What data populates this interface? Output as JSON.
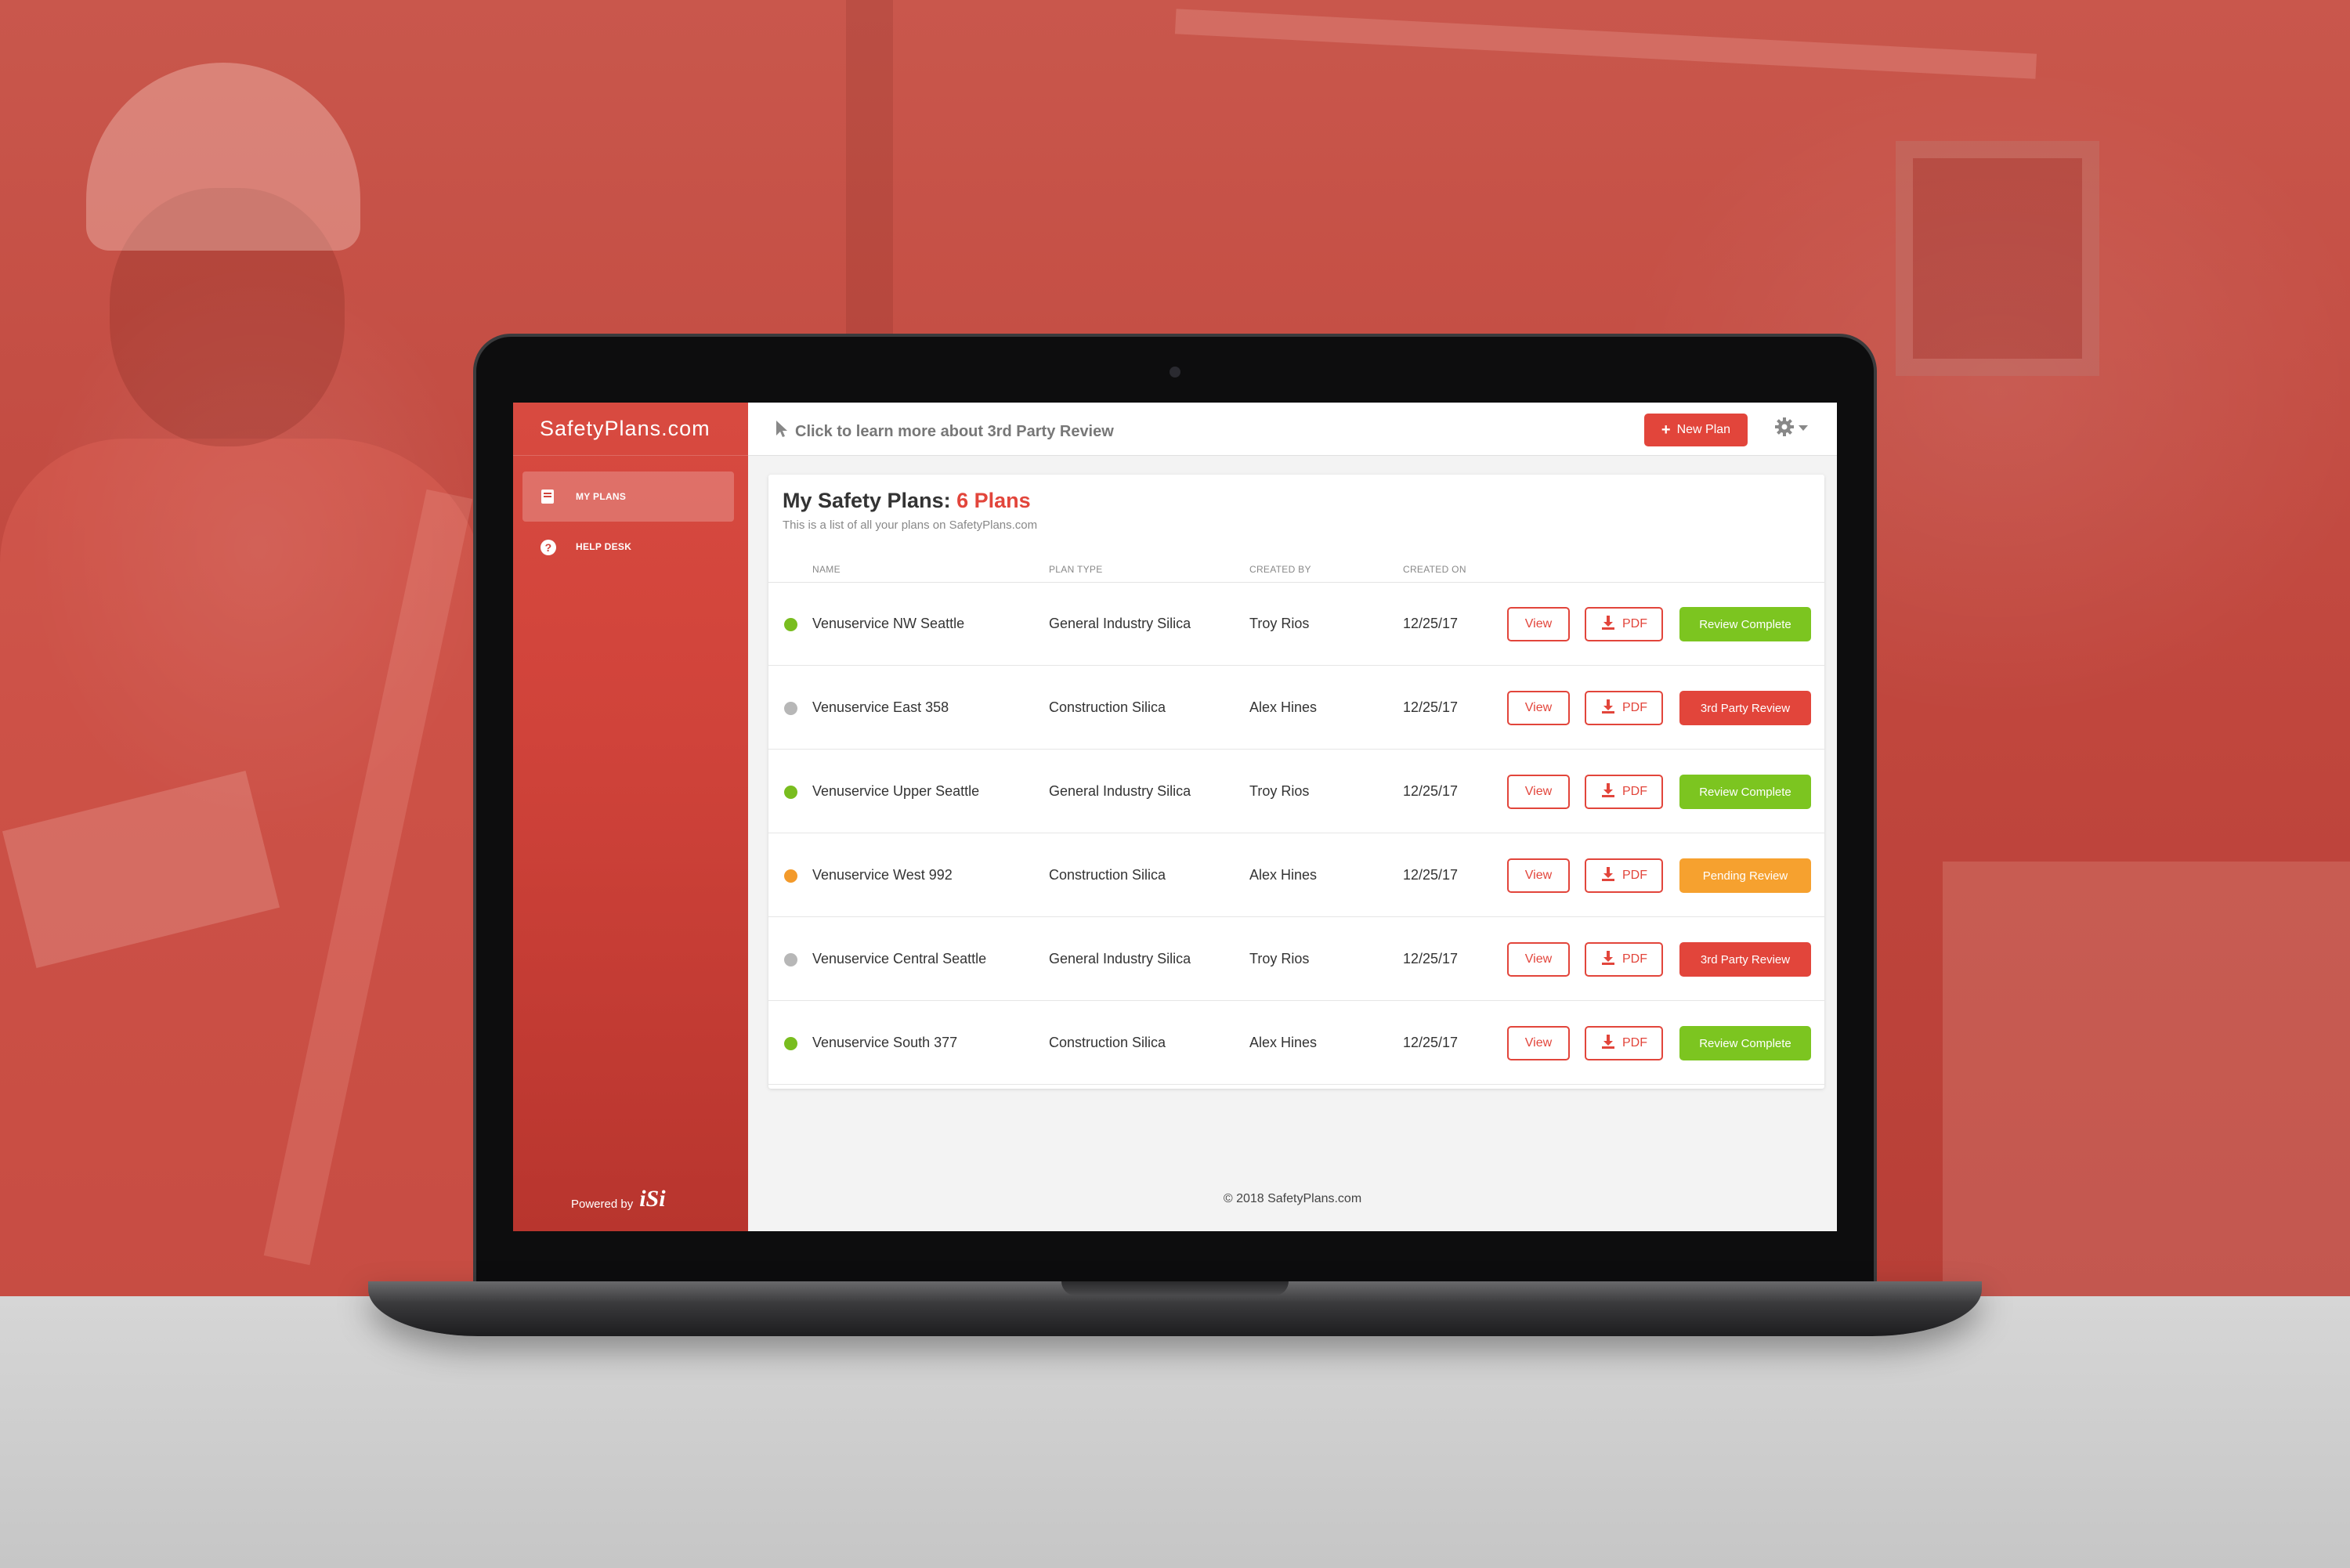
{
  "app": {
    "logo": "SafetyPlans.com",
    "powered_by": "Powered by",
    "powered_brand": "iSi"
  },
  "sidebar": {
    "items": [
      {
        "label": "MY PLANS",
        "icon": "book-icon",
        "active": true
      },
      {
        "label": "HELP DESK",
        "icon": "help-icon",
        "active": false
      }
    ]
  },
  "topbar": {
    "link": "Click to learn more about 3rd Party Review",
    "new_plan_label": "New Plan"
  },
  "main": {
    "title_prefix": "My Safety Plans:",
    "title_count": "6 Plans",
    "subtitle": "This is a list of all your plans on SafetyPlans.com",
    "columns": [
      "NAME",
      "PLAN TYPE",
      "CREATED BY",
      "CREATED ON"
    ],
    "view_label": "View",
    "pdf_label": "PDF",
    "rows": [
      {
        "name": "Venuservice NW Seattle",
        "type": "General Industry Silica",
        "created_by": "Troy Rios",
        "created_on": "12/25/17",
        "dot": "#79bd1f",
        "status": "Review Complete",
        "status_color": "#7cc520"
      },
      {
        "name": "Venuservice East 358",
        "type": "Construction Silica",
        "created_by": "Alex Hines",
        "created_on": "12/25/17",
        "dot": "#b7b7b7",
        "status": "3rd Party Review",
        "status_color": "#e2453b"
      },
      {
        "name": "Venuservice Upper Seattle",
        "type": "General Industry Silica",
        "created_by": "Troy Rios",
        "created_on": "12/25/17",
        "dot": "#79bd1f",
        "status": "Review Complete",
        "status_color": "#7cc520"
      },
      {
        "name": "Venuservice West 992",
        "type": "Construction Silica",
        "created_by": "Alex Hines",
        "created_on": "12/25/17",
        "dot": "#f39a2b",
        "status": "Pending Review",
        "status_color": "#f6a12f"
      },
      {
        "name": "Venuservice Central Seattle",
        "type": "General Industry Silica",
        "created_by": "Troy Rios",
        "created_on": "12/25/17",
        "dot": "#b7b7b7",
        "status": "3rd Party Review",
        "status_color": "#e2453b"
      },
      {
        "name": "Venuservice South 377",
        "type": "Construction Silica",
        "created_by": "Alex Hines",
        "created_on": "12/25/17",
        "dot": "#79bd1f",
        "status": "Review Complete",
        "status_color": "#7cc520"
      }
    ]
  },
  "footer": {
    "copyright": "© 2018 SafetyPlans.com"
  },
  "colors": {
    "accent": "#e2453b",
    "sidebar": "#d0433a",
    "background_tint": "#c0463d"
  }
}
